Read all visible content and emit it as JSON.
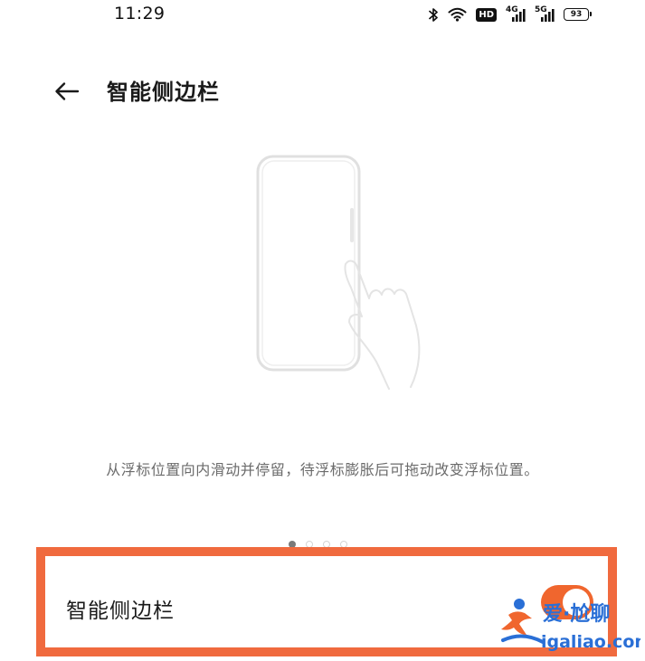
{
  "status_bar": {
    "time": "11:29",
    "network_4g": "4G",
    "network_5g": "5G",
    "hd_label": "HD",
    "battery": "93",
    "icons": [
      "bluetooth-icon",
      "wifi-icon",
      "hd-icon",
      "signal-4g-icon",
      "signal-5g-icon",
      "battery-icon"
    ]
  },
  "header": {
    "back_icon": "arrow-left-icon",
    "title": "智能侧边栏"
  },
  "illustration": {
    "subject": "phone-swipe-gesture"
  },
  "description": {
    "text": "从浮标位置向内滑动并停留，待浮标膨胀后可拖动改变浮标位置。"
  },
  "pager": {
    "count": 4,
    "active_index": 0
  },
  "setting": {
    "label": "智能侧边栏",
    "enabled": true,
    "accent_color": "#f0662e",
    "highlight_color": "#f06a3e"
  },
  "watermark": {
    "line1": "爱·尬聊",
    "line2": "igaliao.com"
  }
}
